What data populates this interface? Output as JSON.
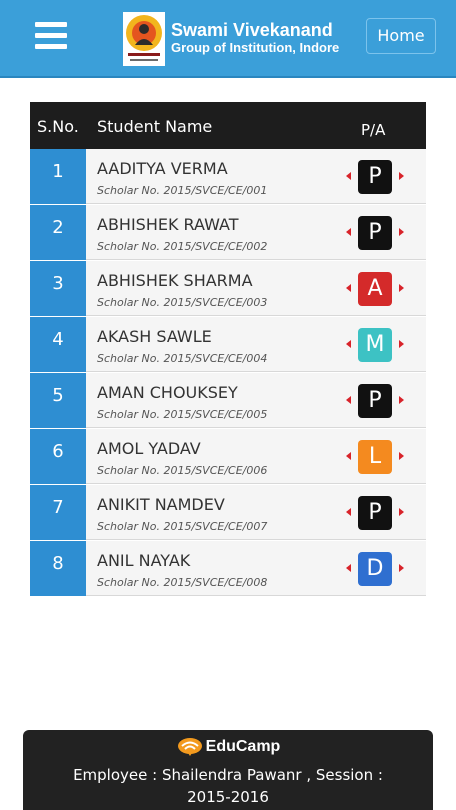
{
  "header": {
    "brand_line1": "Swami Vivekanand",
    "brand_line2": "Group of Institution, Indore",
    "home_label": "Home",
    "bg_color": "#3b9fd9"
  },
  "table": {
    "headers": {
      "sno": "S.No.",
      "name": "Student Name",
      "pa": "P/A"
    },
    "rows": [
      {
        "sno": "1",
        "name": "Aaditya Verma",
        "scholar": "Scholar No. 2015/SVCE/CE/001",
        "status": "P",
        "status_color": "#111111"
      },
      {
        "sno": "2",
        "name": "Abhishek Rawat",
        "scholar": "Scholar No. 2015/SVCE/CE/002",
        "status": "P",
        "status_color": "#111111"
      },
      {
        "sno": "3",
        "name": "Abhishek Sharma",
        "scholar": "Scholar No. 2015/SVCE/CE/003",
        "status": "A",
        "status_color": "#d42a2a"
      },
      {
        "sno": "4",
        "name": "Akash Sawle",
        "scholar": "Scholar No. 2015/SVCE/CE/004",
        "status": "M",
        "status_color": "#3dc2c4"
      },
      {
        "sno": "5",
        "name": "Aman Chouksey",
        "scholar": "Scholar No. 2015/SVCE/CE/005",
        "status": "P",
        "status_color": "#111111"
      },
      {
        "sno": "6",
        "name": "Amol Yadav",
        "scholar": "Scholar No. 2015/SVCE/CE/006",
        "status": "L",
        "status_color": "#f48a1f"
      },
      {
        "sno": "7",
        "name": "Anikit Namdev",
        "scholar": "Scholar No. 2015/SVCE/CE/007",
        "status": "P",
        "status_color": "#111111"
      },
      {
        "sno": "8",
        "name": "Anil Nayak",
        "scholar": "Scholar No. 2015/SVCE/CE/008",
        "status": "D",
        "status_color": "#2f6fd0"
      }
    ]
  },
  "footer": {
    "brand": "EduCamp",
    "info": "Employee : Shailendra Pawanr , Session : 2015-2016"
  }
}
